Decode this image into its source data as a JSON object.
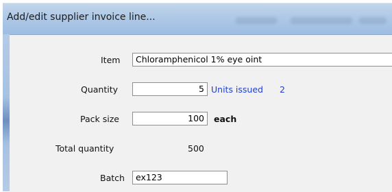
{
  "window": {
    "title": "Add/edit supplier invoice line..."
  },
  "form": {
    "item_label": "Item",
    "item_value": "Chloramphenicol 1% eye oint",
    "quantity_label": "Quantity",
    "quantity_value": "5",
    "units_issued_label": "Units issued",
    "units_issued_value": "2",
    "pack_size_label": "Pack size",
    "pack_size_value": "100",
    "pack_unit": "each",
    "total_quantity_label": "Total quantity",
    "total_quantity_value": "500",
    "batch_label": "Batch",
    "batch_value": "ex123"
  },
  "colors": {
    "titlebar": "#aec8e6",
    "client_background": "#f1f1f1",
    "units_issued_text": "#1f3fd0"
  }
}
